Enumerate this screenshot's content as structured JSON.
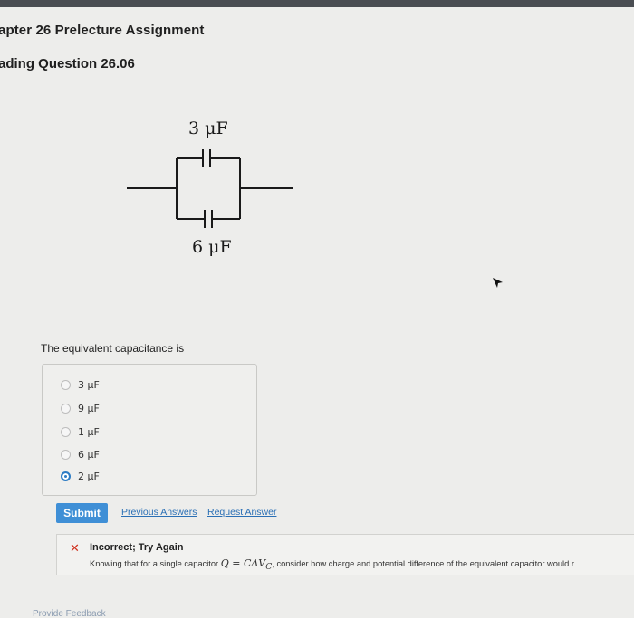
{
  "header": {
    "chapter_title": "apter 26 Prelecture Assignment",
    "question_title": "ading Question 26.06"
  },
  "figure": {
    "top_capacitor_label": "3 μF",
    "bottom_capacitor_label": "6 μF"
  },
  "question": {
    "prompt": "The equivalent capacitance is",
    "choices": [
      {
        "label": "3 μF",
        "selected": false
      },
      {
        "label": "9 μF",
        "selected": false
      },
      {
        "label": "1 μF",
        "selected": false
      },
      {
        "label": "6 μF",
        "selected": false
      },
      {
        "label": "2 μF",
        "selected": true
      }
    ]
  },
  "actions": {
    "submit_label": "Submit",
    "previous_answers_label": "Previous Answers",
    "request_answer_label": "Request Answer"
  },
  "feedback": {
    "title": "Incorrect; Try Again",
    "text_before": "Knowing that for a single capacitor",
    "formula": "Q = CΔV",
    "formula_sub": "C",
    "text_after": ", consider how charge and potential difference of the equivalent capacitor would r"
  },
  "footer": {
    "provide_feedback_label": "Provide Feedback"
  },
  "colors": {
    "accent_blue": "#3f8fd6",
    "link_blue": "#2a6fb5",
    "error_red": "#d0311f"
  }
}
